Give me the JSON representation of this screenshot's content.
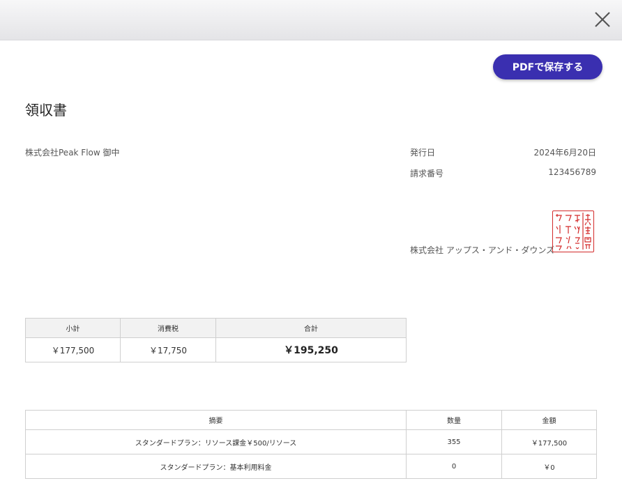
{
  "pdf_button_label": "PDFで保存する",
  "title": "領収書",
  "addressee": "株式会社Peak Flow 御中",
  "issue_date": {
    "label": "発行日",
    "value": "2024年6月20日"
  },
  "invoice_number": {
    "label": "請求番号",
    "value": "123456789"
  },
  "issuer": "株式会社 アップス・アンド・ダウンズ",
  "seal": {
    "text": "株式会社アップス・アンド・ダウンズ",
    "color": "#d32a2a"
  },
  "summary": {
    "headers": [
      "小計",
      "消費税",
      "合計"
    ],
    "values": [
      "￥177,500",
      "￥17,750",
      "￥195,250"
    ]
  },
  "items": {
    "headers": [
      "摘要",
      "数量",
      "金額"
    ],
    "rows": [
      {
        "description": "スタンダードプラン：リソース課金￥500/リソース",
        "quantity": "355",
        "amount": "￥177,500"
      },
      {
        "description": "スタンダードプラン：基本利用料金",
        "quantity": "0",
        "amount": "￥0"
      }
    ]
  },
  "colors": {
    "accent": "#3a2fb0",
    "seal": "#d32a2a"
  }
}
